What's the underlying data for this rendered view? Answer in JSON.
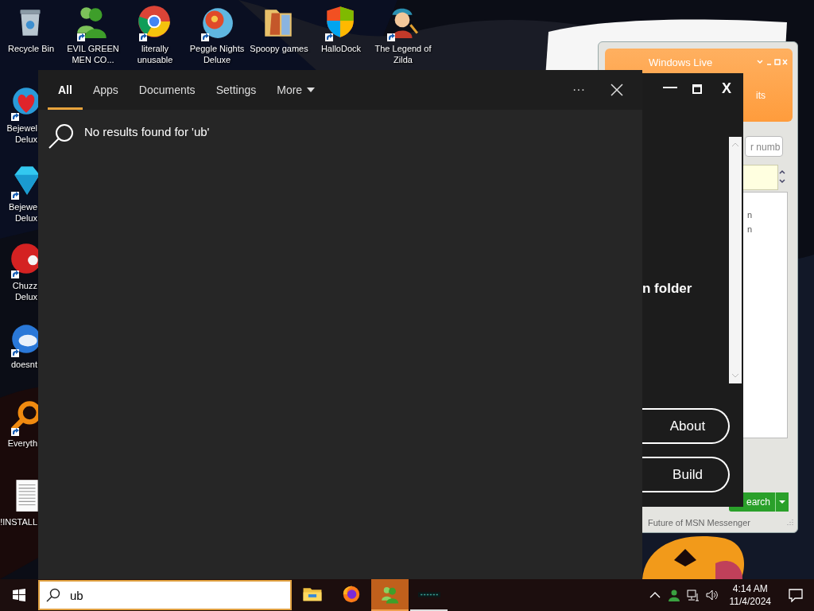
{
  "desktop_icons_top": [
    {
      "label": "Recycle Bin",
      "kind": "trash",
      "shortcut": false
    },
    {
      "label": "EVIL GREEN MEN CO...",
      "kind": "people",
      "shortcut": true
    },
    {
      "label": "literally unusable",
      "kind": "browser",
      "shortcut": true
    },
    {
      "label": "Peggle Nights Deluxe",
      "kind": "ball",
      "shortcut": true
    },
    {
      "label": "Spoopy games",
      "kind": "folder",
      "shortcut": false
    },
    {
      "label": "HalloDock",
      "kind": "shield",
      "shortcut": true
    },
    {
      "label": "The Legend of Zilda",
      "kind": "figure",
      "shortcut": true
    }
  ],
  "desktop_icons_left": [
    {
      "label": "Bejewel Delux",
      "kind": "heart-gem",
      "shortcut": true
    },
    {
      "label": "Bejewe Delux",
      "kind": "diamond",
      "shortcut": true
    },
    {
      "label": "Chuzz Delux",
      "kind": "blob",
      "shortcut": true
    },
    {
      "label": "doesnt",
      "kind": "bird",
      "shortcut": true
    },
    {
      "label": "Everyth",
      "kind": "magnifier",
      "shortcut": true
    },
    {
      "label": "!INSTALL",
      "kind": "document",
      "shortcut": false
    }
  ],
  "messenger_window": {
    "title": "Windows Live",
    "menu_fragment": "its",
    "search_placeholder": "r numb",
    "list_fragments": [
      "n",
      "n"
    ],
    "search_button": "earch",
    "status": "Future of MSN Messenger"
  },
  "app_window": {
    "close_label": "X",
    "text": "n folder",
    "buttons": [
      "About",
      "Build"
    ]
  },
  "search_panel": {
    "tabs": [
      {
        "label": "All",
        "selected": true,
        "dropdown": false
      },
      {
        "label": "Apps",
        "selected": false,
        "dropdown": false
      },
      {
        "label": "Documents",
        "selected": false,
        "dropdown": false
      },
      {
        "label": "Settings",
        "selected": false,
        "dropdown": false
      },
      {
        "label": "More",
        "selected": false,
        "dropdown": true
      }
    ],
    "more_label": "···",
    "message": "No results found for 'ub'"
  },
  "taskbar": {
    "search": {
      "value": "ub"
    },
    "apps": [
      {
        "kind": "explorer",
        "active": false,
        "running": false
      },
      {
        "kind": "firefox",
        "active": false,
        "running": false
      },
      {
        "kind": "messenger",
        "active": true,
        "running": true
      },
      {
        "kind": "chaos",
        "active": false,
        "running": true
      }
    ],
    "time": "4:14 AM",
    "date": "11/4/2024"
  }
}
